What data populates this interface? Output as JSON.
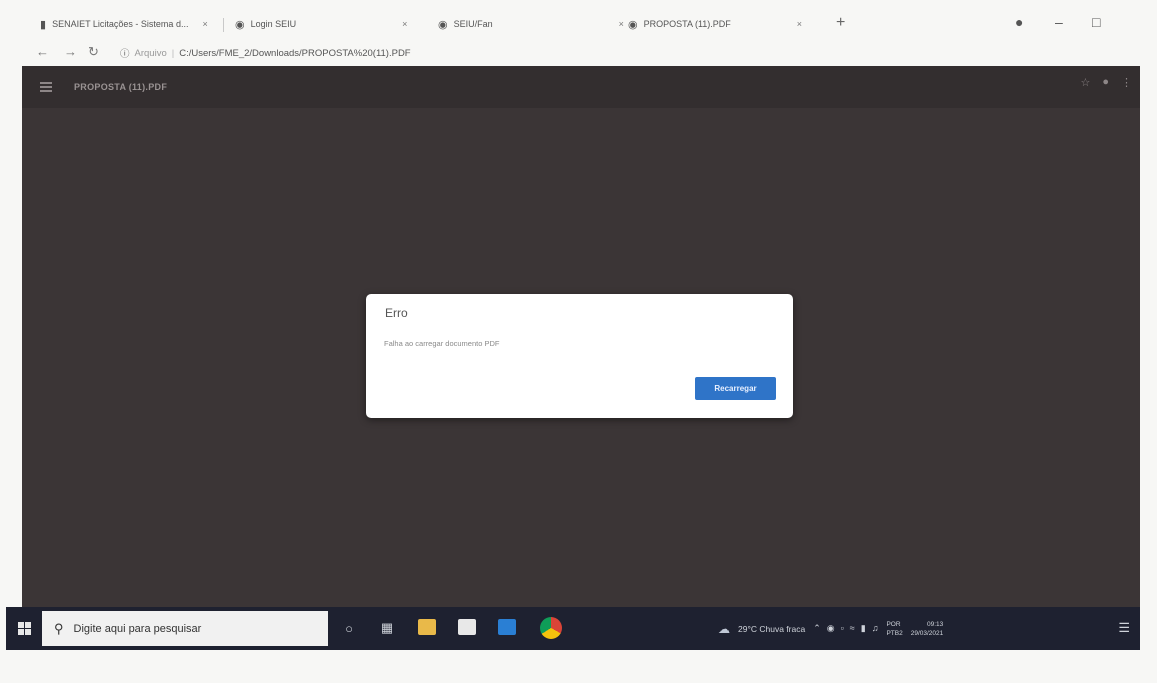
{
  "browser": {
    "tabs": [
      {
        "label": "SENAIET Licitações - Sistema d...",
        "icon": "document-icon"
      },
      {
        "label": "Login SEIU",
        "icon": "globe-icon"
      },
      {
        "label": "SEIU/Fan",
        "icon": "globe-icon"
      },
      {
        "label": "PROPOSTA (11).PDF",
        "icon": "globe-icon"
      }
    ],
    "tab_close": "×",
    "new_tab": "+",
    "address": {
      "scheme": "Arquivo",
      "url": "C:/Users/FME_2/Downloads/PROPOSTA%20(11).PDF"
    }
  },
  "viewer": {
    "title": "PROPOSTA (11).PDF"
  },
  "dialog": {
    "title": "Erro",
    "message": "Falha ao carregar documento PDF",
    "button_label": "Recarregar",
    "button_color": "#2f74c8"
  },
  "taskbar": {
    "search_placeholder": "Digite aqui para pesquisar",
    "weather": "29°C  Chuva fraca",
    "language_top": "POR",
    "language_bottom": "PTB2",
    "time": "09:13",
    "date": "29/03/2021"
  }
}
